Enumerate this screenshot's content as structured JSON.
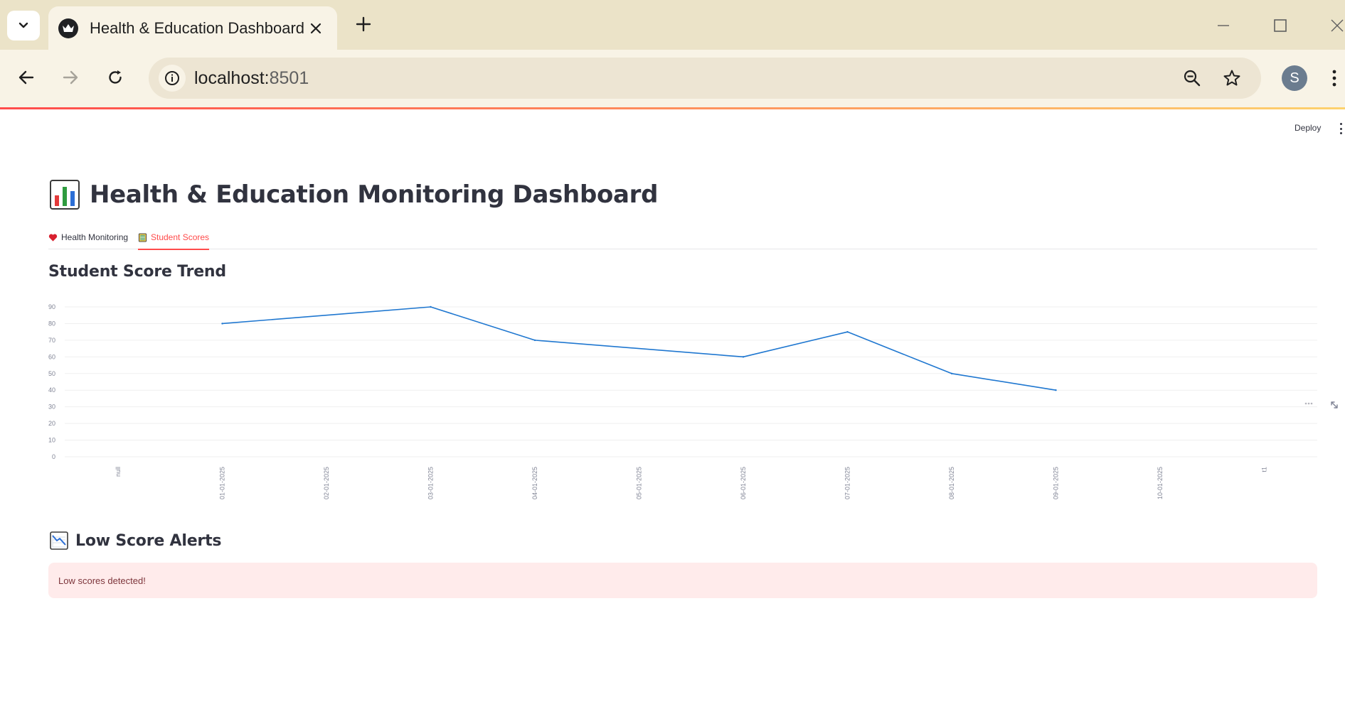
{
  "browser": {
    "tab_title": "Health & Education Dashboard",
    "url_host": "localhost:",
    "url_port": "8501",
    "profile_initial": "S"
  },
  "app": {
    "deploy_label": "Deploy",
    "title": "Health & Education Monitoring Dashboard",
    "tabs": [
      {
        "label": "Health Monitoring",
        "icon": "heart-icon",
        "active": false
      },
      {
        "label": "Student Scores",
        "icon": "notebook-icon",
        "active": true
      }
    ],
    "section_title": "Student Score Trend",
    "alerts_title": "Low Score Alerts",
    "alert_message": "Low scores detected!"
  },
  "colors": {
    "accent": "#ff4b4b",
    "line": "#1f77d0",
    "alert_bg": "#ffebeb",
    "alert_text": "#7d353b"
  },
  "chart_data": {
    "type": "line",
    "title": "Student Score Trend",
    "xlabel": "",
    "ylabel": "",
    "x_ticks": [
      "null",
      "01-01-2025",
      "02-01-2025",
      "03-01-2025",
      "04-01-2025",
      "05-01-2025",
      "06-01-2025",
      "07-01-2025",
      "08-01-2025",
      "09-01-2025",
      "10-01-2025",
      "t1"
    ],
    "y_ticks": [
      0,
      10,
      20,
      30,
      40,
      50,
      60,
      70,
      80,
      90
    ],
    "ylim": [
      0,
      90
    ],
    "grid": true,
    "series": [
      {
        "x": [
          "01-01-2025",
          "03-01-2025",
          "04-01-2025",
          "06-01-2025",
          "07-01-2025",
          "08-01-2025",
          "09-01-2025"
        ],
        "values": [
          80,
          90,
          70,
          60,
          75,
          50,
          40
        ]
      }
    ]
  }
}
